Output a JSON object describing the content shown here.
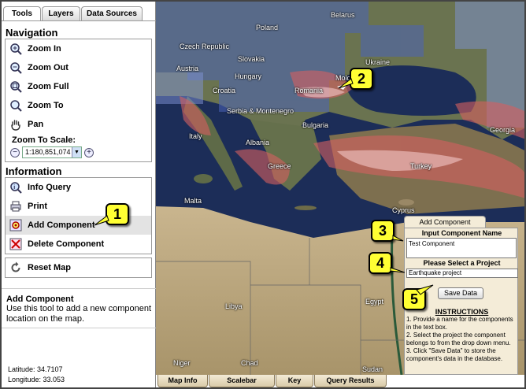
{
  "tabs": [
    {
      "label": "Tools",
      "active": true
    },
    {
      "label": "Layers",
      "active": false
    },
    {
      "label": "Data Sources",
      "active": false
    }
  ],
  "navigation": {
    "title": "Navigation",
    "items": [
      {
        "label": "Zoom In",
        "icon": "zoom-in-icon"
      },
      {
        "label": "Zoom Out",
        "icon": "zoom-out-icon"
      },
      {
        "label": "Zoom Full",
        "icon": "zoom-full-icon"
      },
      {
        "label": "Zoom To",
        "icon": "zoom-to-icon"
      },
      {
        "label": "Pan",
        "icon": "hand-icon"
      }
    ],
    "scale_label": "Zoom To Scale:",
    "scale_value": "1:180,851,074"
  },
  "information": {
    "title": "Information",
    "items": [
      {
        "label": "Info Query",
        "icon": "info-query-icon"
      },
      {
        "label": "Print",
        "icon": "print-icon"
      },
      {
        "label": "Add Component",
        "icon": "add-component-icon",
        "highlighted": true
      },
      {
        "label": "Delete Component",
        "icon": "delete-component-icon"
      }
    ],
    "reset_label": "Reset Map"
  },
  "help": {
    "title": "Add Component",
    "text": "Use this tool to add a new component location on the map."
  },
  "coords": {
    "latitude": "Latitude: 34.7107",
    "longitude": "Longitude: 33.053"
  },
  "map_labels": [
    "Belarus",
    "Poland",
    "Czech Republic",
    "Slovakia",
    "Ukraine",
    "Austria",
    "Hungary",
    "Moldova",
    "Croatia",
    "Romania",
    "Serbia & Montenegro",
    "Bulgaria",
    "Italy",
    "Albania",
    "Georgia",
    "Greece",
    "Turkey",
    "Malta",
    "Cyprus",
    "Libya",
    "Egypt",
    "Niger",
    "Chad",
    "Sudan"
  ],
  "bottom_tabs": [
    "Map Info",
    "Scalebar",
    "Key",
    "Query Results"
  ],
  "add_component_panel": {
    "tab_label": "Add Component",
    "name_heading": "Input Component Name",
    "name_value": "Test Component",
    "project_heading": "Please Select a Project",
    "project_value": "Earthquake project",
    "save_label": "Save Data",
    "instructions_title": "INSTRUCTIONS",
    "instructions": [
      "1. Provide a name for the components in the text box.",
      "2. Select the project the component belongs to from the drop down menu.",
      "3. Click \"Save Data\" to store the component's data in the database."
    ]
  },
  "callouts": [
    "1",
    "2",
    "3",
    "4",
    "5"
  ],
  "colors": {
    "callout": "#ffff33",
    "sea": "#1d2f5a",
    "land": "#b8a784",
    "hazard": "#c85050"
  }
}
